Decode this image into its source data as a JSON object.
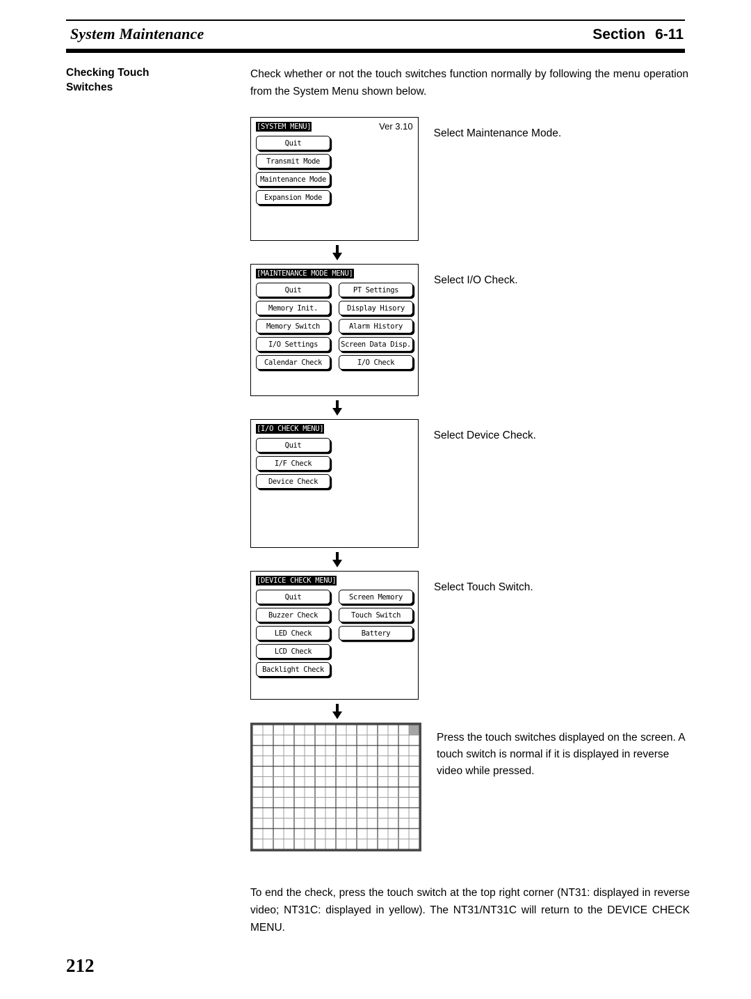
{
  "header": {
    "left_title": "System Maintenance",
    "section_label": "Section",
    "section_number": "6-11"
  },
  "intro": {
    "side_title_line1": "Checking Touch",
    "side_title_line2": "Switches",
    "body": "Check whether or not the touch switches function normally by following the menu operation from the System Menu shown below."
  },
  "flow": {
    "steps": [
      {
        "screen": {
          "title": "[SYSTEM MENU]",
          "version": "Ver 3.10",
          "columns": [
            [
              "Quit",
              "Transmit Mode",
              "Maintenance Mode",
              "Expansion Mode"
            ]
          ]
        },
        "caption": "Select Maintenance Mode."
      },
      {
        "screen": {
          "title": "[MAINTENANCE MODE MENU]",
          "version": "",
          "columns": [
            [
              "Quit",
              "Memory Init.",
              "Memory Switch",
              "I/O Settings",
              "Calendar Check"
            ],
            [
              "PT Settings",
              "Display Hisory",
              "Alarm History",
              "Screen Data Disp.",
              "I/O Check"
            ]
          ]
        },
        "caption": "Select I/O Check."
      },
      {
        "screen": {
          "title": "[I/O CHECK MENU]",
          "version": "",
          "columns": [
            [
              "Quit",
              "I/F Check",
              "Device Check"
            ]
          ]
        },
        "caption": "Select Device Check."
      },
      {
        "screen": {
          "title": "[DEVICE CHECK MENU]",
          "version": "",
          "columns": [
            [
              "Quit",
              "Buzzer Check",
              "LED Check",
              "LCD Check",
              "Backlight Check"
            ],
            [
              "Screen Memory",
              "Touch Switch",
              "Battery"
            ]
          ]
        },
        "caption": "Select Touch Switch."
      }
    ],
    "touch_grid": {
      "columns": 16,
      "rows": 12,
      "highlighted_cell": {
        "col": 16,
        "row": 1
      },
      "caption": "Press the touch switches displayed on the screen. A touch switch is normal if it is displayed in reverse video while pressed."
    }
  },
  "closing": {
    "paragraph": "To end the check, press the touch switch at the top right corner (NT31: displayed in reverse video; NT31C: displayed in yellow). The NT31/NT31C will return to the DEVICE CHECK MENU."
  },
  "page_number": "212",
  "colors": {
    "ink": "#000000",
    "paper": "#ffffff",
    "grid_line_dark": "#3a3a3a",
    "grid_line_light": "#9a9a9a",
    "grid_border": "#4a4a4a"
  }
}
